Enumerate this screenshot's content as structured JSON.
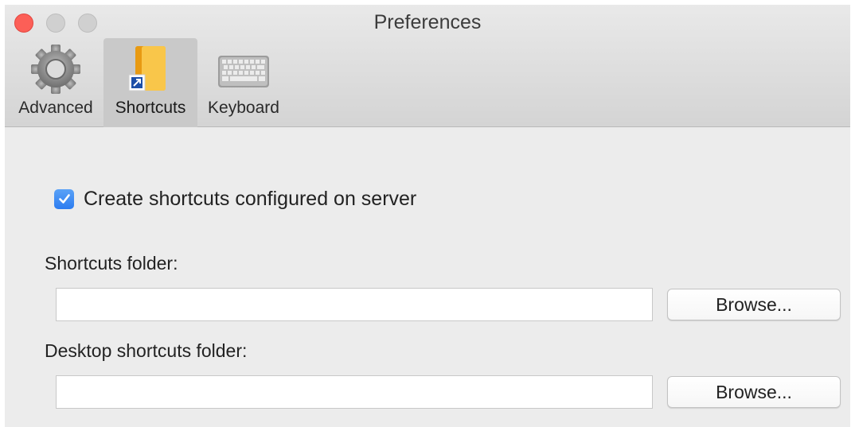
{
  "window": {
    "title": "Preferences"
  },
  "toolbar": {
    "items": [
      {
        "label": "Advanced",
        "icon": "gear-icon",
        "selected": false
      },
      {
        "label": "Shortcuts",
        "icon": "folder-shortcut-icon",
        "selected": true
      },
      {
        "label": "Keyboard",
        "icon": "keyboard-icon",
        "selected": false
      }
    ]
  },
  "shortcuts": {
    "create_on_server": {
      "label": "Create shortcuts configured on server",
      "checked": true
    },
    "shortcuts_folder": {
      "label": "Shortcuts folder:",
      "value": "",
      "browse_label": "Browse..."
    },
    "desktop_folder": {
      "label": "Desktop shortcuts folder:",
      "value": "",
      "browse_label": "Browse..."
    }
  },
  "colors": {
    "close": "#fc5f57",
    "accent": "#2c7cf0",
    "folder": "#f5b324"
  }
}
